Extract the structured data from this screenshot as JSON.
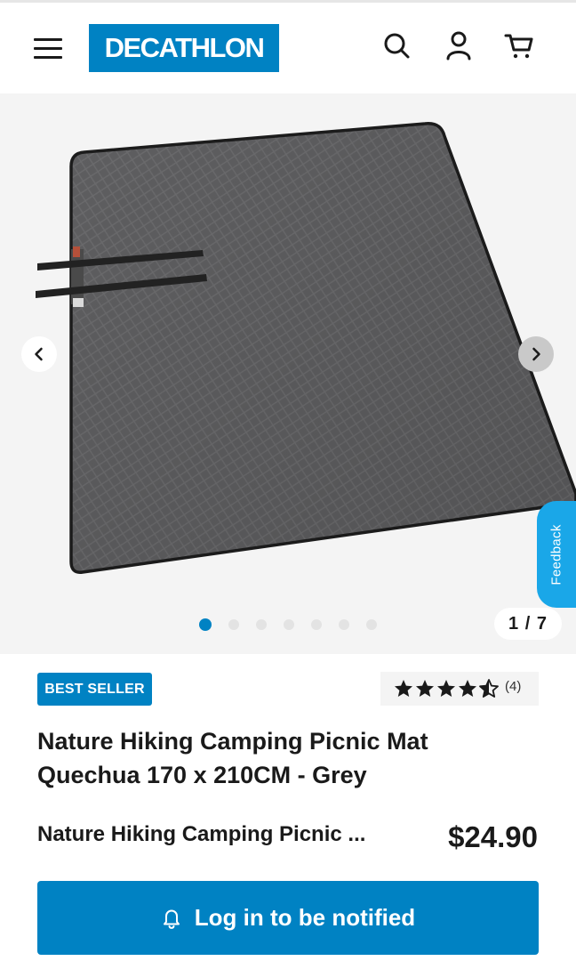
{
  "header": {
    "logo_text": "DECATHLON",
    "brand_color": "#0082c3",
    "icons": [
      "menu-icon",
      "search-icon",
      "user-icon",
      "cart-icon"
    ]
  },
  "gallery": {
    "counter": "1 / 7",
    "current_index": 1,
    "total_images": 7,
    "feedback_label": "Feedback"
  },
  "product": {
    "badge": "BEST SELLER",
    "rating_value": 4.5,
    "rating_count": "(4)",
    "title_line1": "Nature Hiking Camping Picnic Mat",
    "title_line2": "Quechua 170 x 210CM - Grey",
    "variant_name": "Nature Hiking Camping Picnic ...",
    "price": "$24.90"
  },
  "actions": {
    "notify_label": "Log in to be notified"
  }
}
